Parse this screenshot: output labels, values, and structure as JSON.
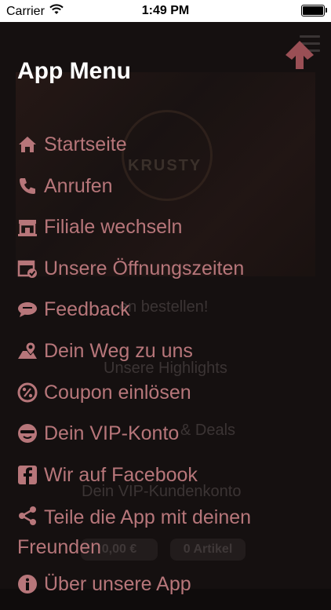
{
  "status_bar": {
    "carrier": "Carrier",
    "time": "1:49 PM"
  },
  "background": {
    "logo_text": "KRUSTY",
    "order_line": "en bestellen!",
    "highlights_line": "Unsere Highlights",
    "deals_line": "& Deals",
    "vip_line": "Dein VIP-Kundenkonto",
    "cart_price": "0,00 €",
    "cart_items": "0 Artikel"
  },
  "menu": {
    "title": "App Menu",
    "items": [
      {
        "label": "Startseite",
        "icon": "home-icon"
      },
      {
        "label": "Anrufen",
        "icon": "phone-icon"
      },
      {
        "label": "Filiale wechseln",
        "icon": "store-icon"
      },
      {
        "label": "Unsere Öffnungszeiten",
        "icon": "calendar-check-icon"
      },
      {
        "label": "Feedback",
        "icon": "chat-icon"
      },
      {
        "label": "Dein Weg zu uns",
        "icon": "map-pin-icon"
      },
      {
        "label": "Coupon einlösen",
        "icon": "coupon-percent-icon"
      },
      {
        "label": "Dein VIP-Konto",
        "icon": "vip-face-icon"
      },
      {
        "label": "Wir auf Facebook",
        "icon": "facebook-icon"
      },
      {
        "label": "Teile die App mit deinen Freunden",
        "icon": "share-icon"
      },
      {
        "label": "Über unsere App",
        "icon": "info-icon"
      }
    ]
  },
  "colors": {
    "menu_text": "#b7767a",
    "title_text": "#ffffff",
    "overlay": "#0f0c0c",
    "accent_arrow": "#9a4f55"
  }
}
